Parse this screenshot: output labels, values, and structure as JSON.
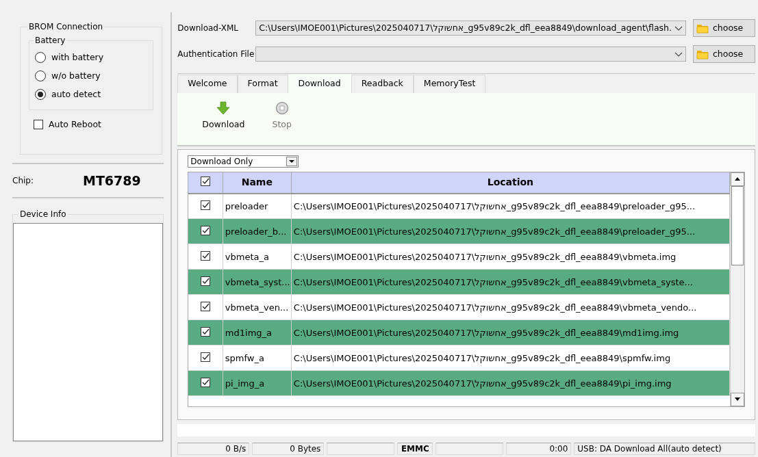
{
  "brom_connection": {
    "title": "BROM Connection",
    "battery": {
      "title": "Battery",
      "options": [
        {
          "label": "with battery",
          "selected": false
        },
        {
          "label": "w/o battery",
          "selected": false
        },
        {
          "label": "auto detect",
          "selected": true
        }
      ]
    },
    "auto_reboot": {
      "label": "Auto Reboot",
      "checked": false
    }
  },
  "chip": {
    "label": "Chip:",
    "value": "MT6789"
  },
  "device_info": {
    "title": "Device Info"
  },
  "download_xml": {
    "label": "Download-XML",
    "value": "C:\\Users\\IMOE001\\Pictures\\2025040717\\אחשוקל_g95v89c2k_dfl_eea8849\\download_agent\\flash.",
    "button": "choose"
  },
  "authentication_file": {
    "label": "Authentication File",
    "button": "choose"
  },
  "tabs": [
    {
      "label": "Welcome",
      "selected": false
    },
    {
      "label": "Format",
      "selected": false
    },
    {
      "label": "Download",
      "selected": true
    },
    {
      "label": "Readback",
      "selected": false
    },
    {
      "label": "MemoryTest",
      "selected": false
    }
  ],
  "toolbar": [
    {
      "kind": "download",
      "label": "Download",
      "disabled": false
    },
    {
      "kind": "stop",
      "label": "Stop",
      "disabled": true
    }
  ],
  "mode_select": {
    "value": "Download Only"
  },
  "table": {
    "header_checked": true,
    "columns": [
      "Name",
      "Location"
    ],
    "rows": [
      {
        "checked": true,
        "name": "preloader",
        "location": "C:\\Users\\IMOE001\\Pictures\\2025040717\\אחשוקל_g95v89c2k_dfl_eea8849\\preloader_g95..."
      },
      {
        "checked": true,
        "name": "preloader_b...",
        "location": "C:\\Users\\IMOE001\\Pictures\\2025040717\\אחשוקל_g95v89c2k_dfl_eea8849\\preloader_g95..."
      },
      {
        "checked": true,
        "name": "vbmeta_a",
        "location": "C:\\Users\\IMOE001\\Pictures\\2025040717\\אחשוקל_g95v89c2k_dfl_eea8849\\vbmeta.img"
      },
      {
        "checked": true,
        "name": "vbmeta_syst...",
        "location": "C:\\Users\\IMOE001\\Pictures\\2025040717\\אחשוקל_g95v89c2k_dfl_eea8849\\vbmeta_syste..."
      },
      {
        "checked": true,
        "name": "vbmeta_ven...",
        "location": "C:\\Users\\IMOE001\\Pictures\\2025040717\\אחשוקל_g95v89c2k_dfl_eea8849\\vbmeta_vendo..."
      },
      {
        "checked": true,
        "name": "md1img_a",
        "location": "C:\\Users\\IMOE001\\Pictures\\2025040717\\אחשוקל_g95v89c2k_dfl_eea8849\\md1img.img"
      },
      {
        "checked": true,
        "name": "spmfw_a",
        "location": "C:\\Users\\IMOE001\\Pictures\\2025040717\\אחשוקל_g95v89c2k_dfl_eea8849\\spmfw.img"
      },
      {
        "checked": true,
        "name": "pi_img_a",
        "location": "C:\\Users\\IMOE001\\Pictures\\2025040717\\אחשוקל_g95v89c2k_dfl_eea8849\\pi_img.img"
      }
    ]
  },
  "progress": {
    "level": 0
  },
  "status_bar": [
    {
      "kind": "text",
      "text": "0 B/s"
    },
    {
      "kind": "text",
      "text": "0 Bytes"
    },
    {
      "kind": "blank"
    },
    {
      "kind": "bold",
      "text": "EMMC"
    },
    {
      "kind": "blank"
    },
    {
      "kind": "text",
      "text": "0:00"
    },
    {
      "kind": "left",
      "text": "USB: DA Download All(auto detect)"
    }
  ]
}
